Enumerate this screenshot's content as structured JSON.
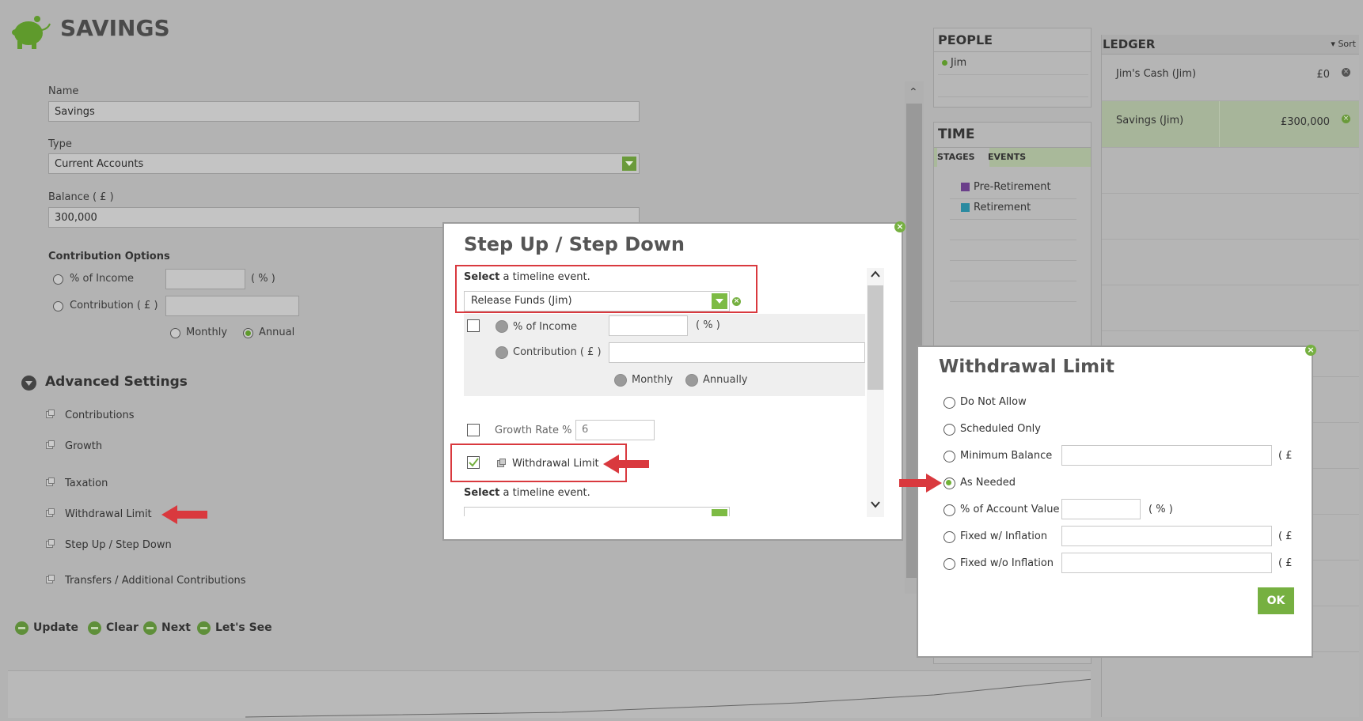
{
  "header": {
    "title": "SAVINGS"
  },
  "form": {
    "name_label": "Name",
    "name_value": "Savings",
    "type_label": "Type",
    "type_value": "Current Accounts",
    "balance_label": "Balance ( £ )",
    "balance_value": "300,000",
    "contrib_title": "Contribution Options",
    "pct_income": "% of Income",
    "pct_unit": "( % )",
    "contribution": "Contribution ( £ )",
    "monthly": "Monthly",
    "annual": "Annual"
  },
  "advanced": {
    "title": "Advanced Settings",
    "items": [
      "Contributions",
      "Growth",
      "Taxation",
      "Withdrawal Limit",
      "Step Up / Step Down",
      "Transfers / Additional Contributions"
    ]
  },
  "actions": {
    "update": "Update",
    "clear": "Clear",
    "next": "Next",
    "lets_see": "Let's See"
  },
  "people": {
    "title": "PEOPLE",
    "items": [
      "Jim"
    ]
  },
  "time": {
    "title": "TIME",
    "tabs": [
      "STAGES",
      "EVENTS"
    ],
    "stages": [
      {
        "label": "Pre-Retirement",
        "color": "#6b3f8a"
      },
      {
        "label": "Retirement",
        "color": "#2a8aa0"
      }
    ]
  },
  "ledger": {
    "title": "LEDGER",
    "sort": "Sort",
    "rows": [
      {
        "name": "Jim's Cash (Jim)",
        "value": "£0"
      },
      {
        "name": "Savings (Jim)",
        "value": "£300,000"
      }
    ]
  },
  "step_dialog": {
    "title": "Step Up / Step Down",
    "select_bold": "Select",
    "select_rest": " a timeline event.",
    "event_value": "Release Funds (Jim)",
    "pct_income": "% of Income",
    "pct_unit": "( % )",
    "contribution": "Contribution ( £ )",
    "monthly": "Monthly",
    "annually": "Annually",
    "growth_label": "Growth Rate %",
    "growth_value": "6",
    "withdrawal_label": "Withdrawal Limit",
    "select2_bold": "Select",
    "select2_rest": " a timeline event."
  },
  "withdrawal_dialog": {
    "title": "Withdrawal Limit",
    "options": [
      "Do Not Allow",
      "Scheduled Only",
      "Minimum Balance",
      "As Needed",
      "% of Account Value",
      "Fixed w/ Inflation",
      "Fixed w/o Inflation"
    ],
    "selected": "As Needed",
    "unit_gbp": "( £ )",
    "unit_pct": "( % )",
    "ok": "OK"
  },
  "colors": {
    "accent_green": "#76b041",
    "highlight_red": "#d9393e"
  }
}
